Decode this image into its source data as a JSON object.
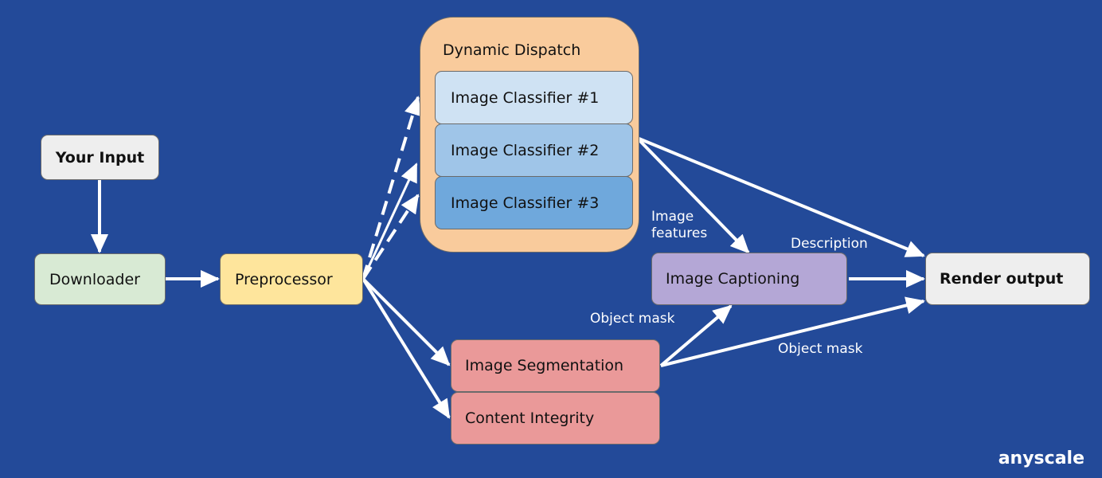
{
  "diagram": {
    "background": "#234a99",
    "nodes": {
      "your_input": {
        "label": "Your Input",
        "color": "#eeeeee"
      },
      "downloader": {
        "label": "Downloader",
        "color": "#d8ead4"
      },
      "preprocessor": {
        "label": "Preprocessor",
        "color": "#fee59c"
      },
      "dynamic_dispatch": {
        "label": "Dynamic Dispatch",
        "color": "#f9cb9c"
      },
      "classifier_1": {
        "label": "Image Classifier #1",
        "color": "#cfe2f3"
      },
      "classifier_2": {
        "label": "Image Classifier #2",
        "color": "#9fc5e8"
      },
      "classifier_3": {
        "label": "Image Classifier #3",
        "color": "#6fa8dc"
      },
      "image_captioning": {
        "label": "Image Captioning",
        "color": "#b4a7d6"
      },
      "render_output": {
        "label": "Render output",
        "color": "#eeeeee"
      },
      "image_segmentation": {
        "label": "Image Segmentation",
        "color": "#ea9999"
      },
      "content_integrity": {
        "label": "Content Integrity",
        "color": "#ea9999"
      }
    },
    "edge_labels": {
      "image_features_line1": "Image",
      "image_features_line2": "features",
      "description": "Description",
      "object_mask_to_captioning": "Object mask",
      "object_mask_to_render": "Object mask"
    },
    "edges": [
      {
        "from": "Your Input",
        "to": "Downloader",
        "style": "solid"
      },
      {
        "from": "Downloader",
        "to": "Preprocessor",
        "style": "solid"
      },
      {
        "from": "Preprocessor",
        "to": "Dynamic Dispatch",
        "style": "dashed"
      },
      {
        "from": "Preprocessor",
        "to": "Dynamic Dispatch",
        "style": "solid"
      },
      {
        "from": "Preprocessor",
        "to": "Dynamic Dispatch",
        "style": "dashed"
      },
      {
        "from": "Preprocessor",
        "to": "Image Segmentation",
        "style": "solid"
      },
      {
        "from": "Preprocessor",
        "to": "Content Integrity",
        "style": "solid"
      },
      {
        "from": "Image Classifier #2",
        "to": "Image Captioning",
        "style": "solid",
        "label": "Image features"
      },
      {
        "from": "Image Classifier #2",
        "to": "Render output",
        "style": "solid"
      },
      {
        "from": "Image Captioning",
        "to": "Render output",
        "style": "solid",
        "label": "Description"
      },
      {
        "from": "Image Segmentation",
        "to": "Image Captioning",
        "style": "solid",
        "label": "Object mask"
      },
      {
        "from": "Image Segmentation",
        "to": "Render output",
        "style": "solid",
        "label": "Object mask"
      }
    ],
    "brand": "anyscale"
  }
}
